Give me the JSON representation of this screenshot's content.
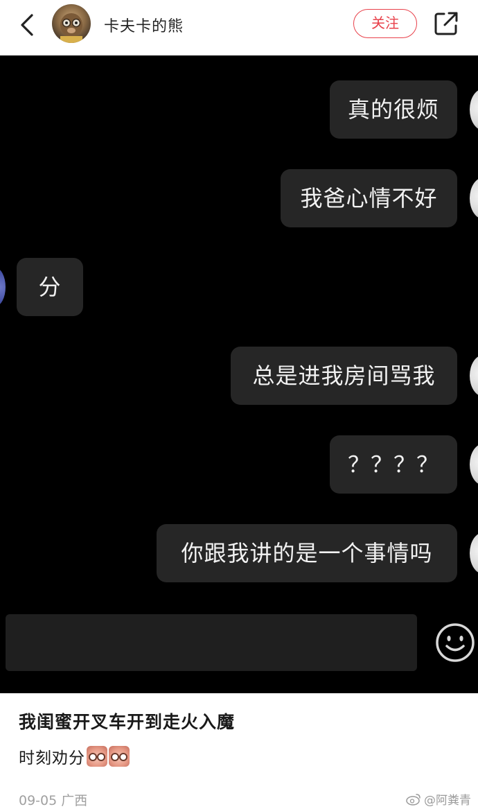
{
  "header": {
    "username": "卡夫卡的熊",
    "follow_label": "关注"
  },
  "chat": {
    "messages": [
      {
        "side": "right",
        "text": "真的很烦"
      },
      {
        "side": "right",
        "text": "我爸心情不好"
      },
      {
        "side": "left",
        "text": "分"
      },
      {
        "side": "right",
        "text": "总是进我房间骂我"
      },
      {
        "side": "right",
        "text": "？？？？"
      },
      {
        "side": "right",
        "text": "你跟我讲的是一个事情吗"
      }
    ]
  },
  "post": {
    "title": "我闺蜜开叉车开到走火入魔",
    "body": "时刻劝分",
    "date": "09-05",
    "location": "广西",
    "watermark": "@阿粪青"
  },
  "icons": {
    "back": "chevron-left-icon",
    "share": "share-icon",
    "emoji": "smiley-icon",
    "weibo": "weibo-icon"
  },
  "colors": {
    "accent": "#e8404a",
    "chat_background": "#000000",
    "bubble": "#262626"
  }
}
